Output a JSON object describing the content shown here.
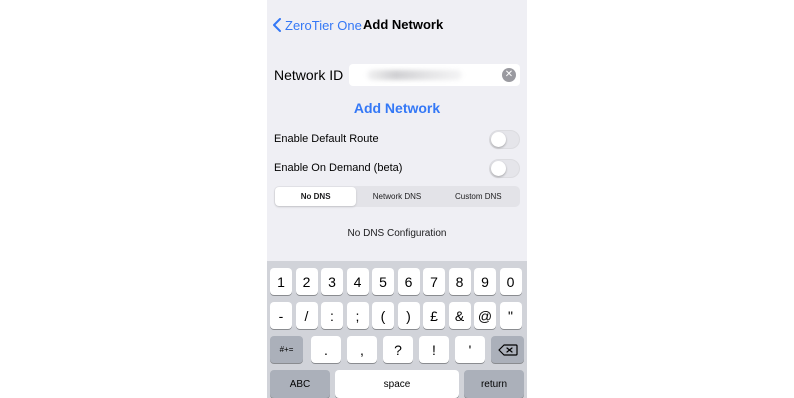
{
  "nav": {
    "back_label": "ZeroTier One",
    "title": "Add Network"
  },
  "form": {
    "network_id_label": "Network ID",
    "network_id_value": "",
    "add_button_label": "Add Network",
    "default_route_label": "Enable Default Route",
    "default_route_on": false,
    "on_demand_label": "Enable On Demand (beta)",
    "on_demand_on": false
  },
  "dns": {
    "segments": [
      "No DNS",
      "Network DNS",
      "Custom DNS"
    ],
    "selected": "No DNS",
    "message": "No DNS Configuration"
  },
  "keyboard": {
    "row1": [
      "1",
      "2",
      "3",
      "4",
      "5",
      "6",
      "7",
      "8",
      "9",
      "0"
    ],
    "row2": [
      "-",
      "/",
      ":",
      ";",
      "(",
      ")",
      "£",
      "&",
      "@",
      "\""
    ],
    "row3": [
      ".",
      ",",
      "?",
      "!",
      "'"
    ],
    "shift_label": "#+=",
    "abc_label": "ABC",
    "space_label": "space",
    "return_label": "return"
  },
  "colors": {
    "accent": "#3478f6",
    "background": "#efeff4",
    "keyboard": "#d1d3d9"
  }
}
